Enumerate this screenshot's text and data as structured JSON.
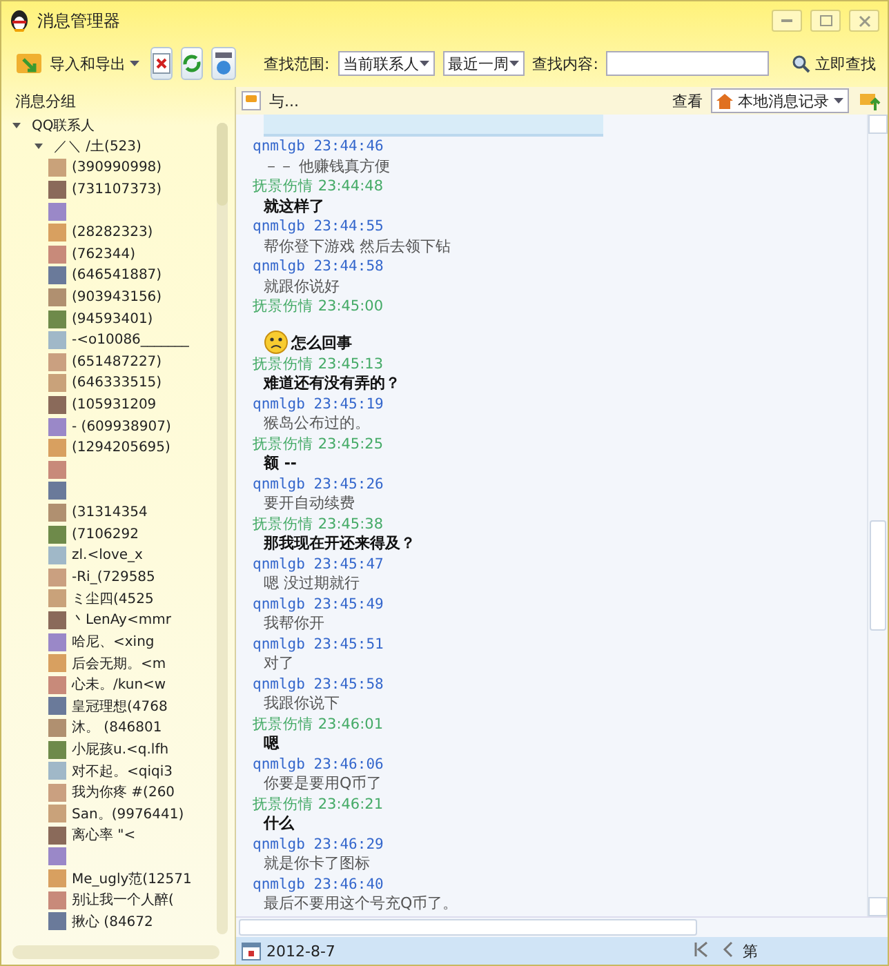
{
  "window": {
    "title": "消息管理器"
  },
  "toolbar": {
    "import_export": "导入和导出",
    "scope_label": "查找范围:",
    "scope_value": "当前联系人",
    "period_value": "最近一周",
    "content_label": "查找内容:",
    "search_button": "立即查找"
  },
  "sidebar": {
    "title": "消息分组",
    "tree": [
      {
        "label": "QQ联系人",
        "expanded": true,
        "children": [
          {
            "label": "／＼ /土(523)",
            "expanded": true,
            "children": [
              {
                "kind": "contact",
                "label": "(390990998)"
              },
              {
                "kind": "contact",
                "label": "(731107373)"
              },
              {
                "kind": "contact"
              },
              {
                "kind": "contact",
                "label": "(28282323)"
              },
              {
                "kind": "contact",
                "label": "(762344)"
              },
              {
                "kind": "contact",
                "label": "(646541887)"
              },
              {
                "kind": "contact",
                "label": "(903943156)"
              },
              {
                "kind": "contact",
                "label": "(94593401)"
              },
              {
                "kind": "contact",
                "label": "-<o10086_______"
              },
              {
                "kind": "contact",
                "label": "(651487227)"
              },
              {
                "kind": "contact",
                "label": "(646333515)"
              },
              {
                "kind": "contact",
                "label": "(105931209"
              },
              {
                "kind": "contact",
                "label": "-   (609938907)"
              },
              {
                "kind": "contact",
                "label": "(1294205695)"
              },
              {
                "kind": "contact"
              },
              {
                "kind": "contact"
              },
              {
                "kind": "contact",
                "label": "(31314354"
              },
              {
                "kind": "contact",
                "label": "(7106292"
              },
              {
                "kind": "contact",
                "label": "zl.<love_x"
              },
              {
                "kind": "contact",
                "label": "-Ri_(729585"
              },
              {
                "kind": "contact",
                "label": "ミ尘四(4525"
              },
              {
                "kind": "contact",
                "label": "丶LenAy<mmr"
              },
              {
                "kind": "contact",
                "label": "哈尼、<xing"
              },
              {
                "kind": "contact",
                "label": "后会无期。<m"
              },
              {
                "kind": "contact",
                "label": "心未。/kun<w"
              },
              {
                "kind": "contact",
                "label": "皇冠理想(4768"
              },
              {
                "kind": "contact",
                "label": "沐。 (846801"
              },
              {
                "kind": "contact",
                "label": "小屁孩u.<q.lfh"
              },
              {
                "kind": "contact",
                "label": "对不起。<qiqi3"
              },
              {
                "kind": "contact",
                "label": "我为你疼 #(260"
              },
              {
                "kind": "contact",
                "label": "San。(9976441)"
              },
              {
                "kind": "contact",
                "label": "离心率 \"<"
              },
              {
                "kind": "contact"
              },
              {
                "kind": "contact",
                "label": "Me_ugly范(12571"
              },
              {
                "kind": "contact",
                "label": "别让我一个人醉("
              },
              {
                "kind": "contact",
                "label": "揪心 (84672"
              }
            ]
          }
        ]
      }
    ]
  },
  "chat": {
    "title": "与...",
    "view_label": "查看",
    "view_value": "本地消息记录",
    "messages": [
      {
        "sender": "qnmlgb",
        "time": "23:44:46",
        "text": "－－ 他赚钱真方便",
        "from_self": false,
        "emoticon": false
      },
      {
        "sender": "抚景伤情",
        "time": "23:44:48",
        "text": "就这样了",
        "from_self": true,
        "emoticon": false
      },
      {
        "sender": "qnmlgb",
        "time": "23:44:55",
        "text": "帮你登下游戏   然后去领下钻",
        "from_self": false,
        "emoticon": false
      },
      {
        "sender": "qnmlgb",
        "time": "23:44:58",
        "text": "就跟你说好",
        "from_self": false,
        "emoticon": false
      },
      {
        "sender": "抚景伤情",
        "time": "23:45:00",
        "text": "怎么回事",
        "from_self": true,
        "emoticon": true
      },
      {
        "sender": "抚景伤情",
        "time": "23:45:13",
        "text": "难道还有没有弄的？",
        "from_self": true,
        "emoticon": false
      },
      {
        "sender": "qnmlgb",
        "time": "23:45:19",
        "text": "猴岛公布过的。",
        "from_self": false,
        "emoticon": false
      },
      {
        "sender": "抚景伤情",
        "time": "23:45:25",
        "text": "额 --",
        "from_self": true,
        "emoticon": false
      },
      {
        "sender": "qnmlgb",
        "time": "23:45:26",
        "text": "要开自动续费",
        "from_self": false,
        "emoticon": false
      },
      {
        "sender": "抚景伤情",
        "time": "23:45:38",
        "text": "那我现在开还来得及？",
        "from_self": true,
        "emoticon": false
      },
      {
        "sender": "qnmlgb",
        "time": "23:45:47",
        "text": "嗯  没过期就行",
        "from_self": false,
        "emoticon": false
      },
      {
        "sender": "qnmlgb",
        "time": "23:45:49",
        "text": "我帮你开",
        "from_self": false,
        "emoticon": false
      },
      {
        "sender": "qnmlgb",
        "time": "23:45:51",
        "text": "对了",
        "from_self": false,
        "emoticon": false
      },
      {
        "sender": "qnmlgb",
        "time": "23:45:58",
        "text": "我跟你说下",
        "from_self": false,
        "emoticon": false
      },
      {
        "sender": "抚景伤情",
        "time": "23:46:01",
        "text": "嗯",
        "from_self": true,
        "emoticon": false
      },
      {
        "sender": "qnmlgb",
        "time": "23:46:06",
        "text": "你要是要用Q币了",
        "from_self": false,
        "emoticon": false
      },
      {
        "sender": "抚景伤情",
        "time": "23:46:21",
        "text": "什么",
        "from_self": true,
        "emoticon": false
      },
      {
        "sender": "qnmlgb",
        "time": "23:46:29",
        "text": "就是你卡了图标",
        "from_self": false,
        "emoticon": false
      },
      {
        "sender": "qnmlgb",
        "time": "23:46:40",
        "text": "最后不要用这个号充Q币了。",
        "from_self": false,
        "emoticon": false
      }
    ]
  },
  "status_bar": {
    "date": "2012-8-7",
    "page_label": "第"
  }
}
